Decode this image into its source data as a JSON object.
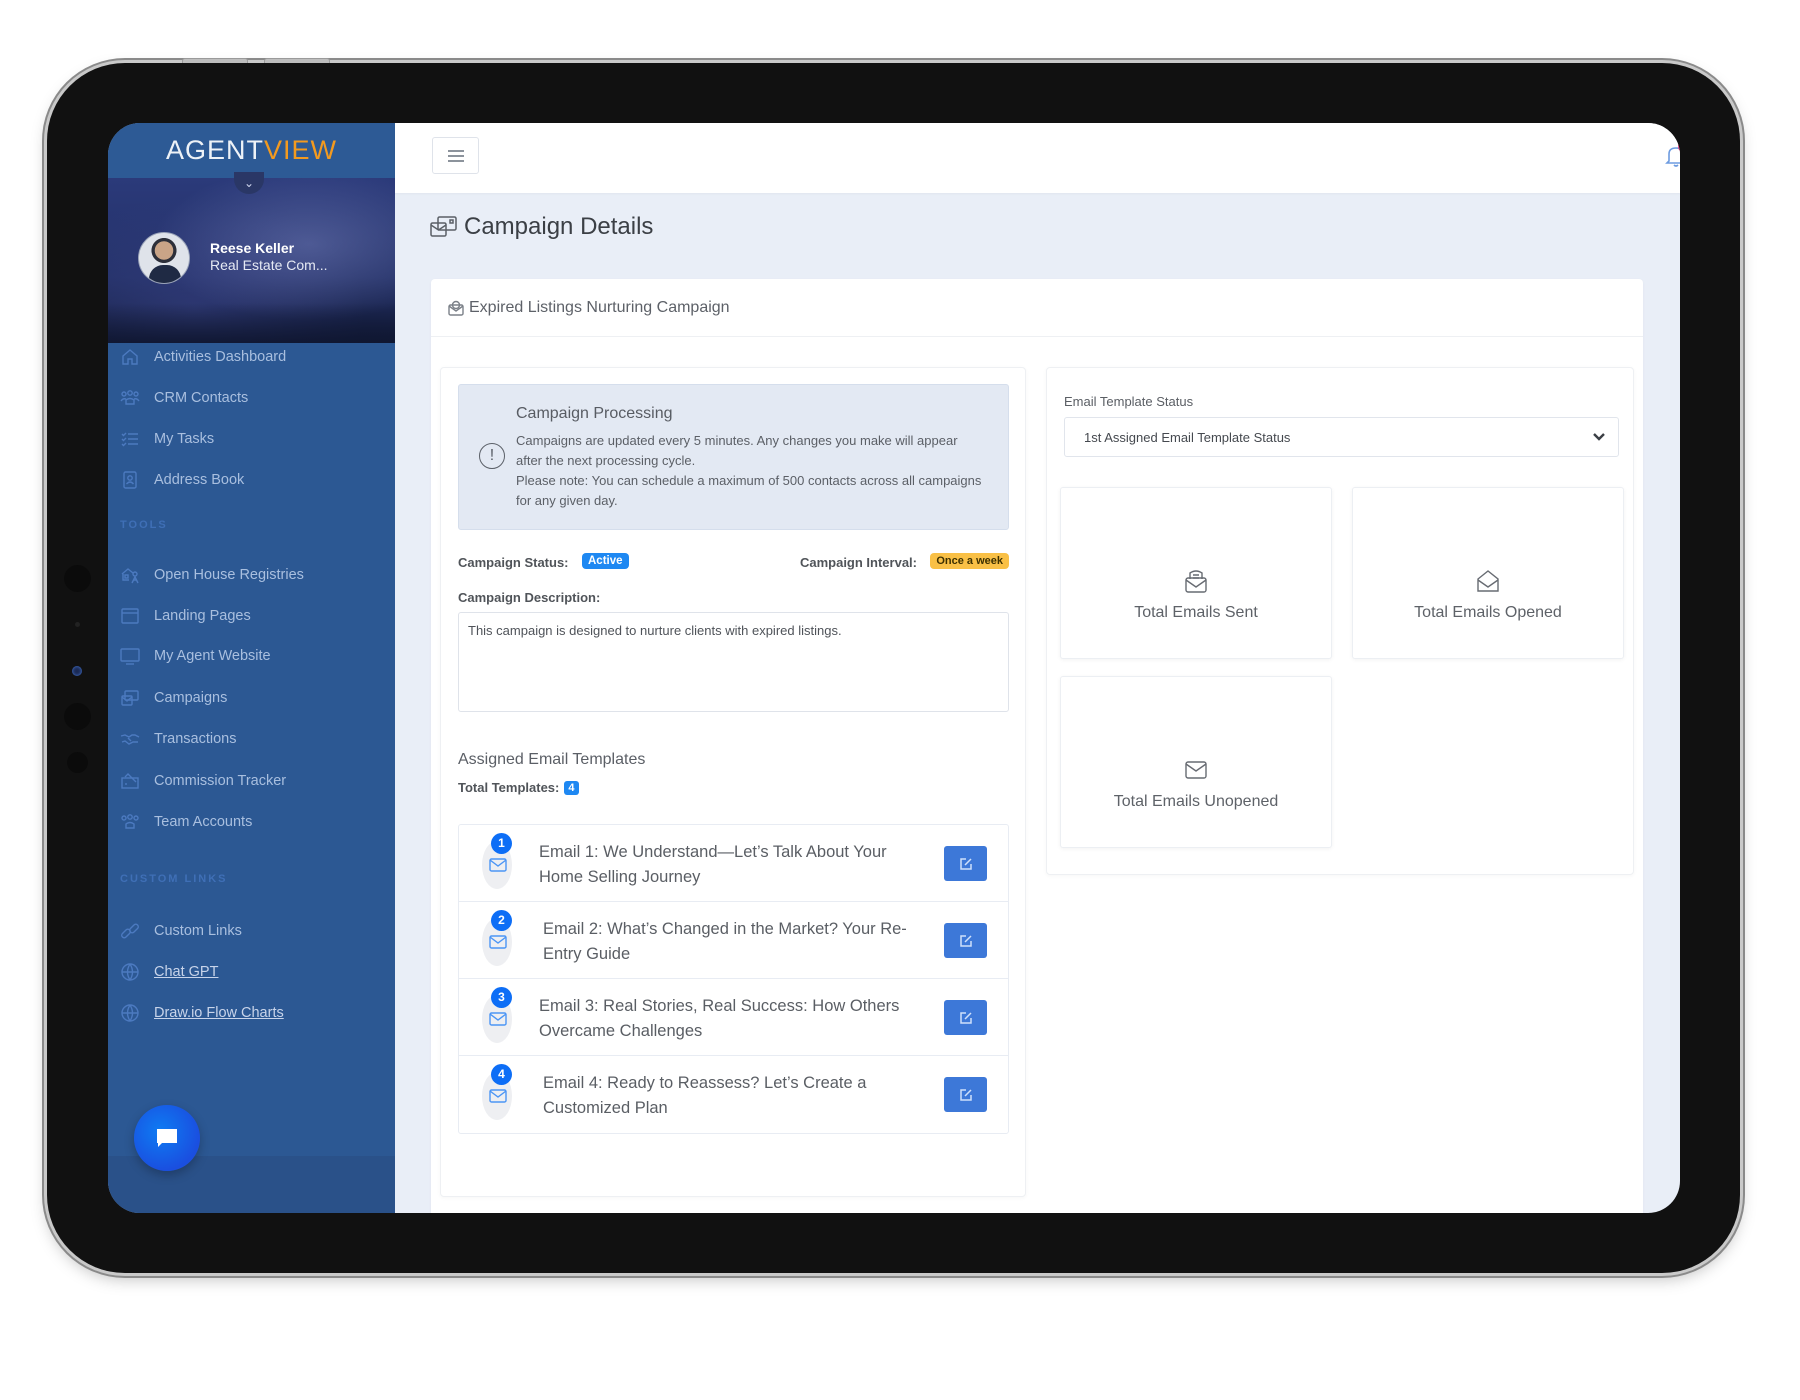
{
  "app": {
    "logo_part1": "AGENT",
    "logo_part2": "VIEW",
    "brand_color": "#2c5893",
    "accent_color": "#f39a1f"
  },
  "user": {
    "name": "Reese Keller",
    "role": "Real Estate Com...",
    "notifications_count": "0"
  },
  "sidebar": {
    "main_items": [
      {
        "label": "Activities Dashboard",
        "icon": "home-icon"
      },
      {
        "label": "CRM Contacts",
        "icon": "users-icon"
      },
      {
        "label": "My Tasks",
        "icon": "checklist-icon"
      },
      {
        "label": "Address Book",
        "icon": "address-book-icon"
      }
    ],
    "tools_label": "TOOLS",
    "tools_items": [
      {
        "label": "Open House Registries",
        "icon": "open-house-icon"
      },
      {
        "label": "Landing Pages",
        "icon": "browser-window-icon"
      },
      {
        "label": "My Agent Website",
        "icon": "monitor-icon"
      },
      {
        "label": "Campaigns",
        "icon": "campaigns-icon"
      },
      {
        "label": "Transactions",
        "icon": "handshake-icon"
      },
      {
        "label": "Commission Tracker",
        "icon": "commission-icon"
      },
      {
        "label": "Team Accounts",
        "icon": "team-icon"
      }
    ],
    "custom_links_label": "CUSTOM LINKS",
    "custom_items": [
      {
        "label": "Custom Links",
        "icon": "link-icon"
      },
      {
        "label": "Chat GPT",
        "icon": "globe-icon"
      },
      {
        "label": "Draw.io Flow Charts",
        "icon": "globe-icon"
      }
    ]
  },
  "page": {
    "title": "Campaign Details",
    "campaign_name": "Expired Listings Nurturing Campaign"
  },
  "alert": {
    "title": "Campaign Processing",
    "line1": "Campaigns are updated every 5 minutes. Any changes you make will appear after the next processing cycle.",
    "line2": "Please note: You can schedule a maximum of 500 contacts across all campaigns for any given day."
  },
  "campaign": {
    "status_label": "Campaign Status:",
    "status_value": "Active",
    "interval_label": "Campaign Interval:",
    "interval_value": "Once a week",
    "description_label": "Campaign Description:",
    "description": "This campaign is designed to nurture clients with expired listings."
  },
  "templates": {
    "section_title": "Assigned Email Templates",
    "total_label": "Total Templates:",
    "total": "4",
    "items": [
      {
        "number": "1",
        "title": "Email 1: We Understand—Let’s Talk About Your Home Selling Journey"
      },
      {
        "number": "2",
        "title": "Email 2: What’s Changed in the Market? Your Re-Entry Guide"
      },
      {
        "number": "3",
        "title": "Email 3: Real Stories, Real Success: How Others Overcame Challenges"
      },
      {
        "number": "4",
        "title": "Email 4: Ready to Reassess? Let’s Create a Customized Plan"
      }
    ]
  },
  "stats": {
    "select_label": "Email Template Status",
    "select_value": "1st Assigned Email Template Status",
    "cards": [
      {
        "label": "Total Emails Sent",
        "icon": "email-sent-icon"
      },
      {
        "label": "Total Emails Opened",
        "icon": "email-opened-icon"
      },
      {
        "label": "Total Emails Unopened",
        "icon": "email-unopened-icon"
      }
    ]
  }
}
